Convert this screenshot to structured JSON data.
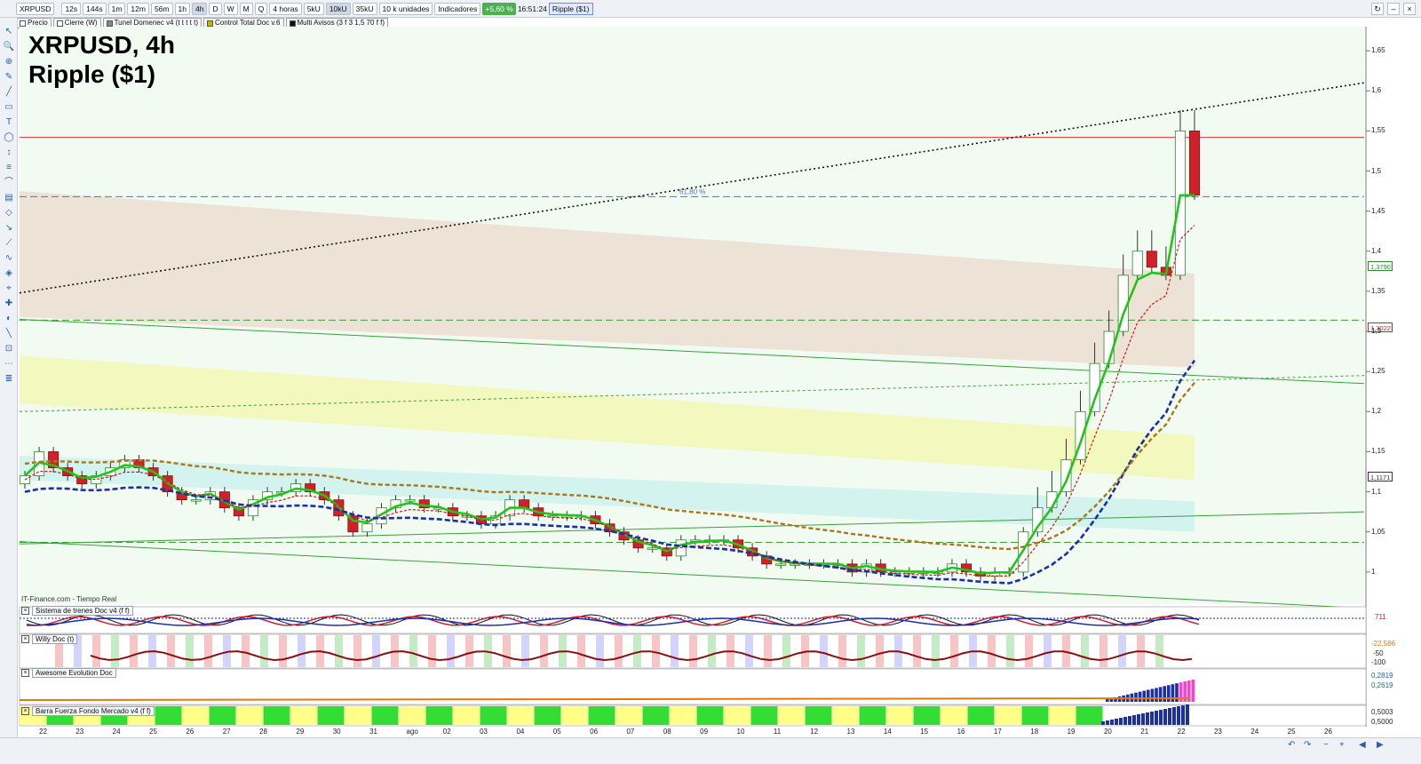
{
  "toolbar": {
    "symbol": "XRPUSD",
    "timeframes": [
      "12s",
      "144s",
      "1m",
      "12m",
      "56m",
      "1h",
      "4h",
      "D",
      "W",
      "M",
      "Q"
    ],
    "active_timeframe": "4h",
    "period_select": "4 horas",
    "volume_buttons": [
      "5kU",
      "10kU",
      "35kU"
    ],
    "units_select": "10 k unidades",
    "indicators_label": "Indicadores",
    "change_badge": "+5,60 %",
    "time": "16:51:24",
    "instrument_name": "Ripple ($1)"
  },
  "legend": {
    "price": "Precio",
    "close": "Cierre (W)",
    "tunnel": "Tunel Domenec v4 (t t t t t)",
    "control": "Control Total Doc v.6",
    "multi": "Multi Avisos (3 f 3 1,5 70 f f)"
  },
  "chart_title_line1": "XRPUSD, 4h",
  "chart_title_line2": "Ripple ($1)",
  "watermark": "IT-Finance.com - Tiempo Real",
  "fib_label": "61,80 %",
  "panels": {
    "p1": "Sistema de trenes Doc v4 (f f)",
    "p2": "Willy Doc (t)",
    "p3": "Awesome Evolution Doc",
    "p4": "Barra Fuerza Fondo Mercado v4 (f f)"
  },
  "panel_values": {
    "p1_right": "711",
    "p2_a": "-22,586",
    "p2_b": "-50",
    "p2_c": "-100",
    "p3_a": "0,2819",
    "p3_b": "0,2619",
    "p4_a": "0,5003",
    "p4_b": "0,5000"
  },
  "price_tags": {
    "green": "1,3790",
    "red": "1,3022",
    "blue": "1,1171"
  },
  "colors": {
    "up": "#2c8a2c",
    "down": "#d0202a",
    "green_ma": "#22c41a",
    "blue_ma": "#1b2fa8",
    "red_ma": "#d01818"
  },
  "chart_data": {
    "type": "candlestick",
    "title": "XRPUSD, 4h",
    "subtitle": "Ripple ($1)",
    "y_tick_labels": [
      "1",
      "1,05",
      "1,1",
      "1,15",
      "1,2",
      "1,25",
      "1,3",
      "1,35",
      "1,4",
      "1,45",
      "1,5",
      "1,55",
      "1,6",
      "1,65"
    ],
    "ylim": [
      0.96,
      1.68
    ],
    "x_tick_labels": [
      "22",
      "23",
      "24",
      "25",
      "26",
      "27",
      "28",
      "29",
      "30",
      "31",
      "ago",
      "02",
      "03",
      "04",
      "05",
      "06",
      "07",
      "08",
      "09",
      "10",
      "11",
      "12",
      "13",
      "14",
      "15",
      "16",
      "17",
      "18",
      "19",
      "20",
      "21",
      "22",
      "23",
      "24",
      "25",
      "26"
    ],
    "horizontal_levels": [
      {
        "value": 1.542,
        "color": "#e0303a",
        "style": "solid"
      },
      {
        "value": 1.468,
        "color": "#5a6adf",
        "style": "dashed"
      },
      {
        "value": 1.314,
        "color": "#3aa03a",
        "style": "dashed"
      },
      {
        "value": 1.037,
        "color": "#3aa03a",
        "style": "dashed"
      }
    ],
    "close_series": [
      1.12,
      1.15,
      1.13,
      1.12,
      1.11,
      1.12,
      1.13,
      1.14,
      1.13,
      1.12,
      1.1,
      1.09,
      1.09,
      1.1,
      1.08,
      1.07,
      1.09,
      1.1,
      1.1,
      1.11,
      1.1,
      1.09,
      1.07,
      1.05,
      1.06,
      1.08,
      1.09,
      1.09,
      1.08,
      1.08,
      1.07,
      1.07,
      1.06,
      1.07,
      1.09,
      1.08,
      1.07,
      1.07,
      1.07,
      1.07,
      1.06,
      1.05,
      1.04,
      1.03,
      1.03,
      1.02,
      1.04,
      1.04,
      1.04,
      1.04,
      1.03,
      1.02,
      1.01,
      1.01,
      1.01,
      1.01,
      1.01,
      1.01,
      1.0,
      1.01,
      1.0,
      1.0,
      1.0,
      1.0,
      1.0,
      1.01,
      1.0,
      0.995,
      1.0,
      1.0,
      1.05,
      1.08,
      1.1,
      1.14,
      1.2,
      1.26,
      1.3,
      1.37,
      1.4,
      1.38,
      1.37,
      1.55,
      1.47
    ]
  }
}
